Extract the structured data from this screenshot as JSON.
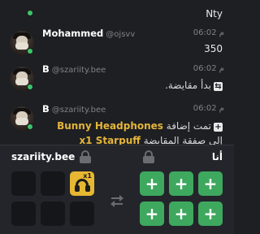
{
  "chat": {
    "top_message": {
      "text": "Nty"
    },
    "messages": [
      {
        "name": "Mohammed",
        "handle": "@ojsvv",
        "time": "06:02 م",
        "text": "350"
      },
      {
        "name": "B",
        "handle": "@szariity.bee",
        "time": "06:02 م",
        "text": "بدأ مقايضة."
      },
      {
        "name": "B",
        "handle": "@szariity.bee",
        "time": "06:02 م",
        "line1_prefix": "تمت إضافة",
        "line1_item": "Bunny Headphones",
        "line2_item": "x1 Starpuff",
        "line2_suffix": "إلى صفقة المقايضة"
      }
    ]
  },
  "trade": {
    "left_user": "szariity.bee",
    "right_user": "أنا",
    "item_quantity": "x1",
    "add_symbol": "+"
  },
  "colors": {
    "add_green": "#3ea85e",
    "item_gold": "#e6b732",
    "online_green": "#3fc468"
  },
  "icons": {
    "lock": "lock-icon",
    "swap": "swap-arrows-icon",
    "system": "plus-box-icon"
  }
}
